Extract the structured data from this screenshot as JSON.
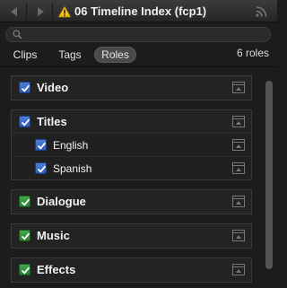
{
  "window": {
    "title": "06 Timeline Index (fcp1)",
    "icons": [
      "back-arrow-icon",
      "forward-arrow-icon",
      "warning-icon",
      "signal-icon"
    ]
  },
  "search": {
    "placeholder": "",
    "value": ""
  },
  "tabs": [
    {
      "label": "Clips",
      "selected": false
    },
    {
      "label": "Tags",
      "selected": false
    },
    {
      "label": "Roles",
      "selected": true
    }
  ],
  "roles_count": "6 roles",
  "roles": [
    {
      "label": "Video",
      "checked": true,
      "color": "#3b6fd0",
      "subroles": []
    },
    {
      "label": "Titles",
      "checked": true,
      "color": "#3b6fd0",
      "subroles": [
        {
          "label": "English",
          "checked": true
        },
        {
          "label": "Spanish",
          "checked": true
        }
      ]
    },
    {
      "label": "Dialogue",
      "checked": true,
      "color": "#35963f",
      "subroles": []
    },
    {
      "label": "Music",
      "checked": true,
      "color": "#35963f",
      "subroles": []
    },
    {
      "label": "Effects",
      "checked": true,
      "color": "#35963f",
      "subroles": []
    }
  ],
  "colors": {
    "video_role": "#3b6fd0",
    "audio_role": "#35963f",
    "background": "#1c1c1c"
  }
}
